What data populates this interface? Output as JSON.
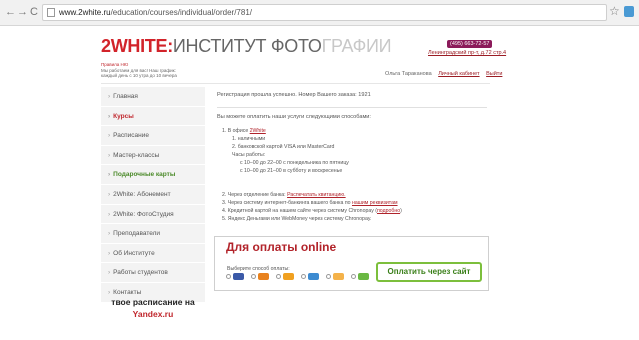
{
  "browser": {
    "back": "←",
    "forward": "→",
    "reload": "C",
    "url_host": "www.2white.ru",
    "url_path": "/education/courses/individual/order/781/",
    "star": "☆"
  },
  "header": {
    "logo_bold": "2WHITE:",
    "logo_mid": "ИНСТИТУТ ФОТО",
    "logo_tail": "ГРАФИИ",
    "tagline_title": "Правила НЮ",
    "tagline_line1": "Мы работаем для вас! Наш график:",
    "tagline_line2": "каждый день с 10 утра до 10 вечера",
    "phone": "(495) 663-72-57",
    "address": "Ленинградский пр-т, д.72 стр.4",
    "user_name": "Ольга Тараканова",
    "cabinet_link": "Личный кабинет",
    "logout_link": "Выйти"
  },
  "sidebar": {
    "items": [
      {
        "label": "Главная",
        "state": "normal"
      },
      {
        "label": "Курсы",
        "state": "active"
      },
      {
        "label": "Расписание",
        "state": "normal"
      },
      {
        "label": "Мастер-классы",
        "state": "normal"
      },
      {
        "label": "Подарочные карты",
        "state": "highlight"
      },
      {
        "label": "2White: Абонемент",
        "state": "normal"
      },
      {
        "label": "2White: ФотоСтудия",
        "state": "normal"
      },
      {
        "label": "Преподаватели",
        "state": "normal"
      },
      {
        "label": "Об Институте",
        "state": "normal"
      },
      {
        "label": "Работы студентов",
        "state": "normal"
      },
      {
        "label": "Контакты",
        "state": "normal"
      }
    ],
    "promo_line1": "твое расписание на",
    "promo_line2": "Yandex.ru"
  },
  "main": {
    "message": "Регистрация прошла успешно. Номер Вашего заказа: 1921",
    "lead": "Вы можете оплатить наши услуги следующими способами:",
    "opt1_prefix": "1.  В офисе ",
    "opt1_link": "2White",
    "opt1_sub1": "1.  наличными",
    "opt1_sub2": "2.  банковской картой VISA или MasterCard",
    "opt1_hours_title": "Часы работы:",
    "opt1_hours1": "с 10–00 до 22–00 с понедельника по пятницу",
    "opt1_hours2": "с 10–00 до 21–00 в субботу и воскресенье",
    "opt2_prefix": "2.  Через отделение банка: ",
    "opt2_link": "Распечатать квитанцию.",
    "opt3_prefix": "3.  Через систему интернет-банкинга вашего банка по ",
    "opt3_link": "нашим реквизитам",
    "opt4_prefix": "4.  Кредитной картой на нашем сайте через систему Chronopay (",
    "opt4_link": "подробно",
    "opt4_suffix": ")",
    "opt5": "5.  Яндекс Деньгами или WebMoney через систему Chronopay."
  },
  "online": {
    "title": "Для оплаты online",
    "subtitle": "Выберите способ оплаты:",
    "methods": [
      {
        "name": "visa",
        "color": "#3b5aa8"
      },
      {
        "name": "mastercard",
        "color": "#e8821e"
      },
      {
        "name": "yandex-money",
        "color": "#f0a020"
      },
      {
        "name": "webmoney",
        "color": "#3d8bd1"
      },
      {
        "name": "chronopay",
        "color": "#f4b24a"
      },
      {
        "name": "other",
        "color": "#6ab843"
      }
    ],
    "button": "Оплатить через сайт"
  }
}
